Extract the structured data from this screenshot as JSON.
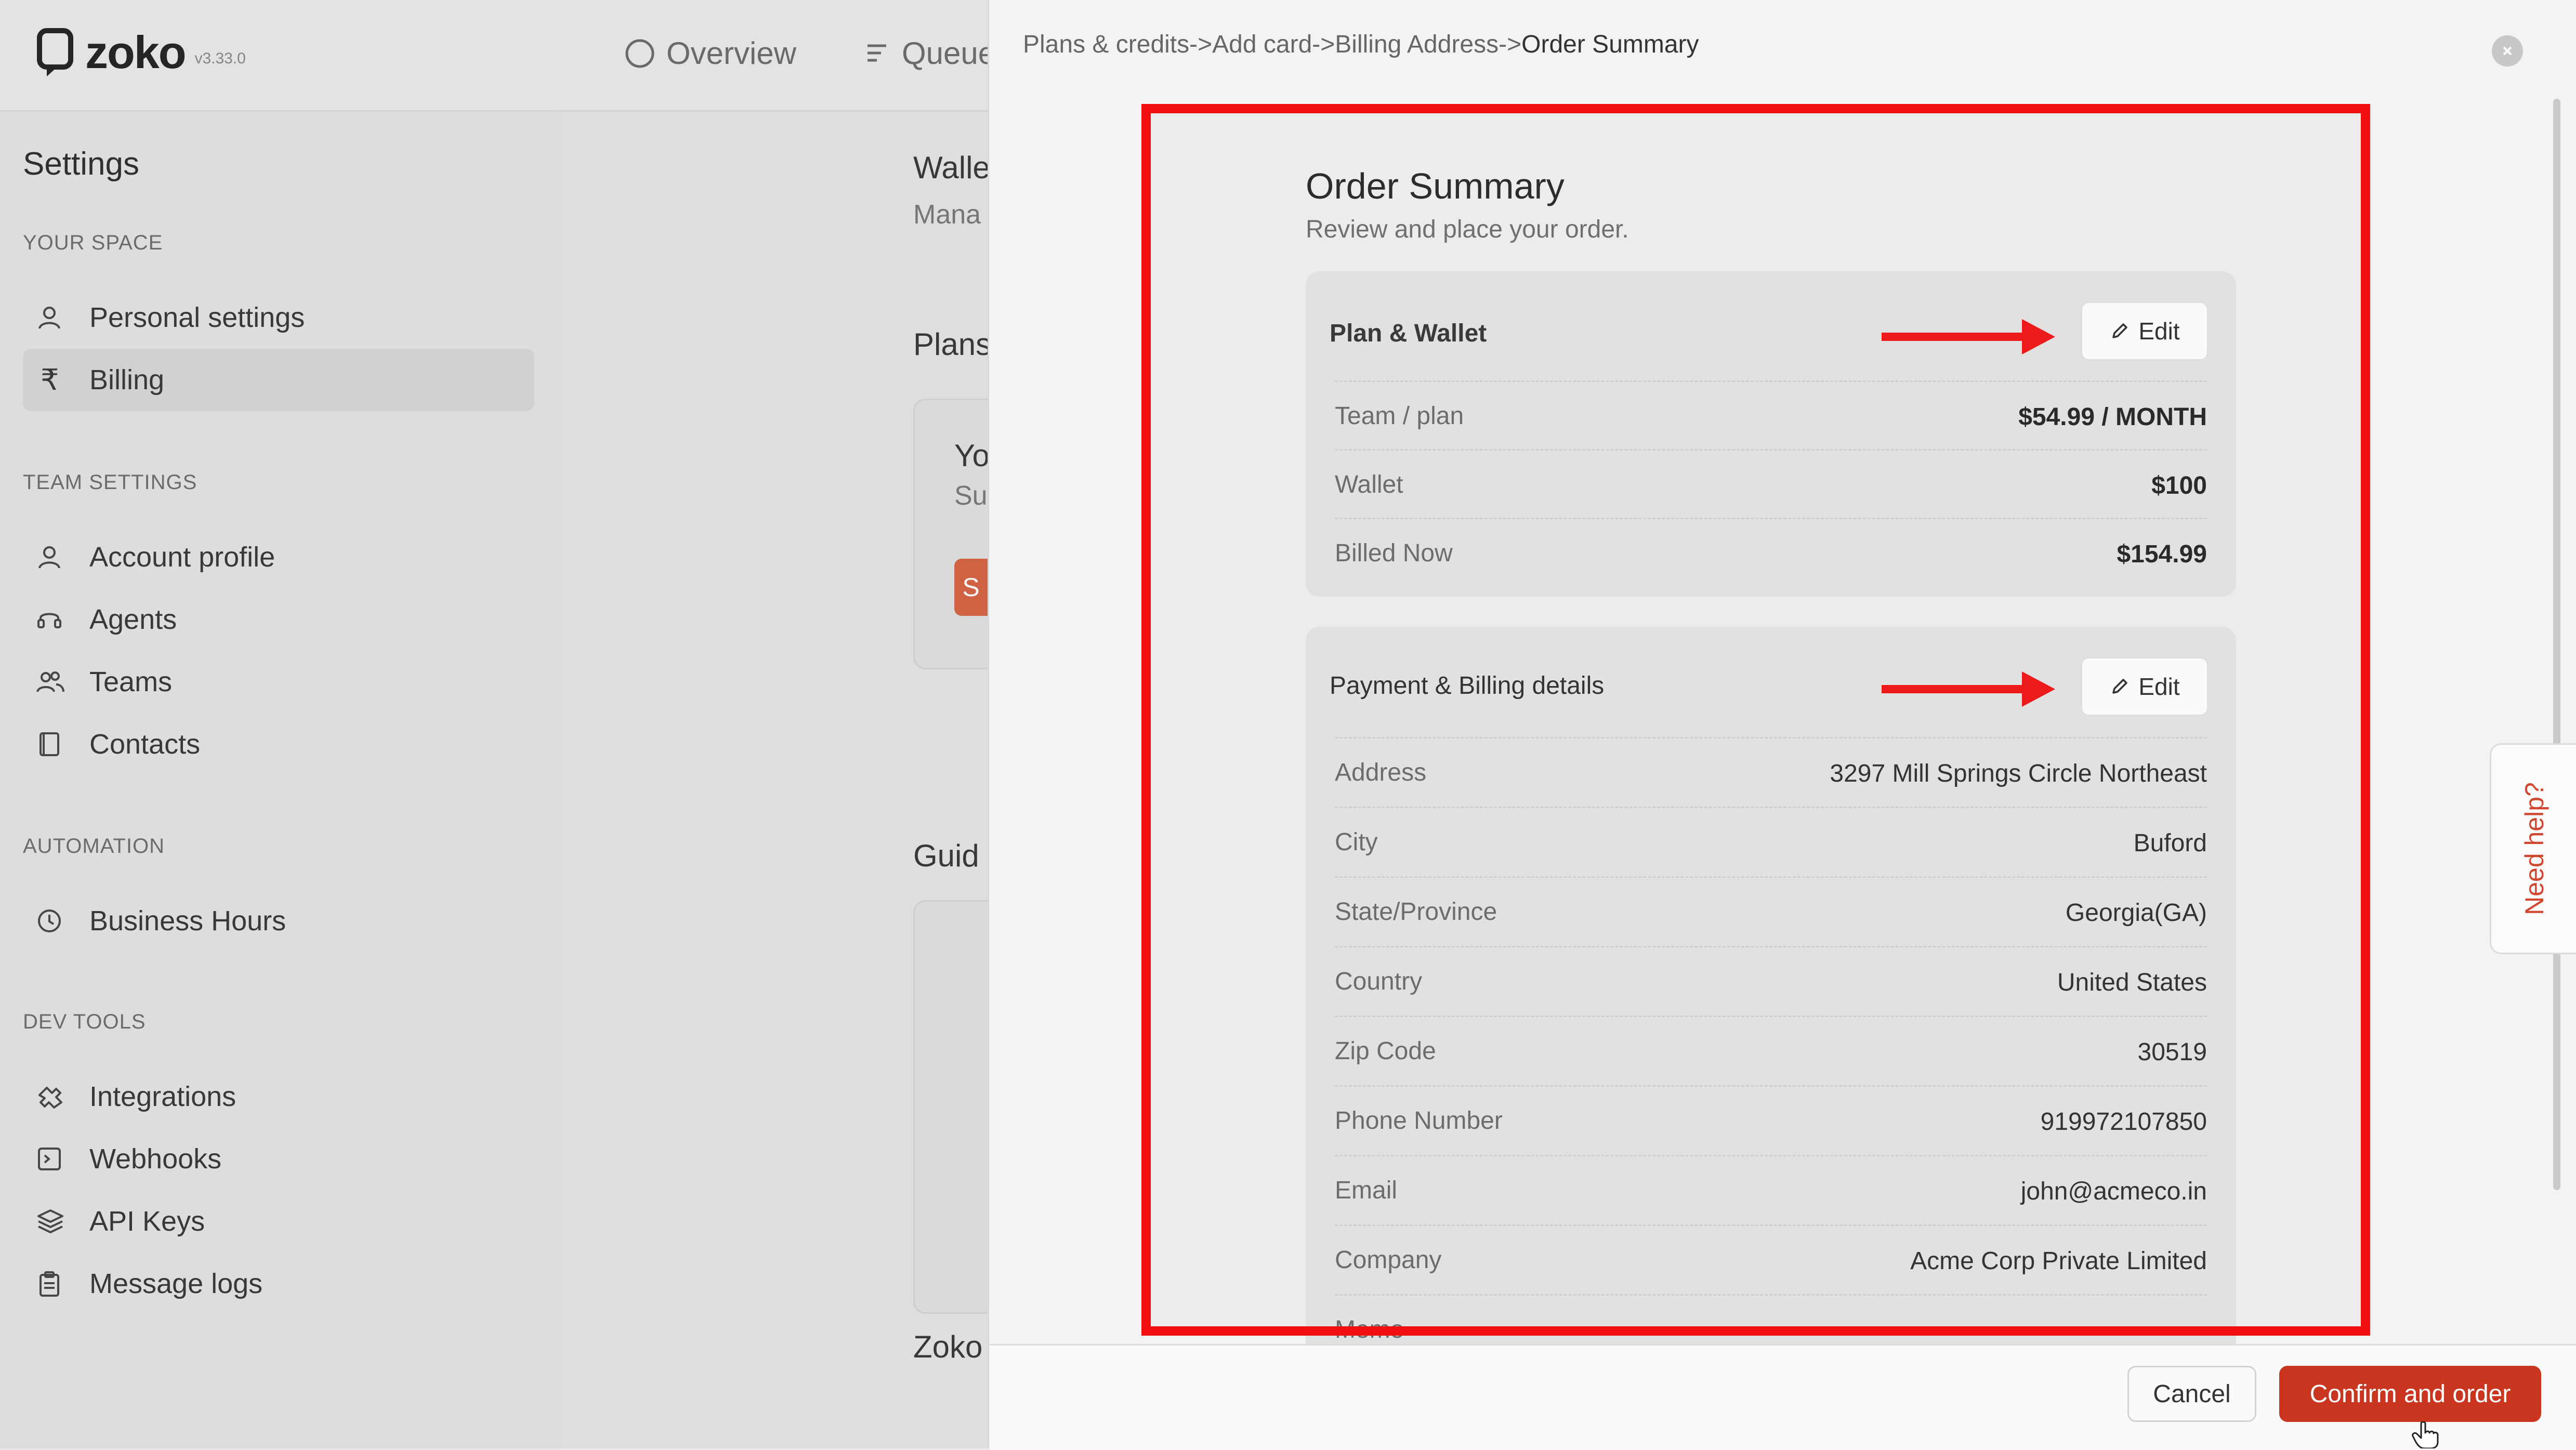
{
  "app": {
    "name": "zoko",
    "version": "v3.33.0"
  },
  "nav": {
    "overview": "Overview",
    "queue": "Queue"
  },
  "sidebar": {
    "title": "Settings",
    "your_space": "YOUR SPACE",
    "personal_settings": "Personal settings",
    "billing": "Billing",
    "team_settings": "TEAM SETTINGS",
    "account_profile": "Account profile",
    "agents": "Agents",
    "teams": "Teams",
    "contacts": "Contacts",
    "automation": "AUTOMATION",
    "business_hours": "Business Hours",
    "dev_tools": "DEV TOOLS",
    "integrations": "Integrations",
    "webhooks": "Webhooks",
    "api_keys": "API Keys",
    "message_logs": "Message logs"
  },
  "background": {
    "wallet": "Walle",
    "manage": "Mana",
    "plans": "Plans",
    "yo": "Yo",
    "su": "Su",
    "btn": "S",
    "guide": "Guid",
    "zoko": "Zoko"
  },
  "breadcrumb": {
    "trail": "Plans & credits->Add card->Billing Address->",
    "current": "Order Summary"
  },
  "order": {
    "title": "Order Summary",
    "subtitle": "Review and place your order.",
    "plan_wallet": {
      "heading": "Plan & Wallet",
      "edit": "Edit",
      "rows": [
        {
          "label": "Team / plan",
          "value": "$54.99 / MONTH"
        },
        {
          "label": "Wallet",
          "value": "$100"
        },
        {
          "label": "Billed Now",
          "value": "$154.99"
        }
      ]
    },
    "billing": {
      "heading": "Payment & Billing details",
      "edit": "Edit",
      "rows": [
        {
          "label": "Address",
          "value": "3297 Mill Springs Circle Northeast"
        },
        {
          "label": "City",
          "value": "Buford"
        },
        {
          "label": "State/Province",
          "value": "Georgia(GA)"
        },
        {
          "label": "Country",
          "value": "United States"
        },
        {
          "label": "Zip Code",
          "value": "30519"
        },
        {
          "label": "Phone Number",
          "value": "919972107850"
        },
        {
          "label": "Email",
          "value": "john@acmeco.in"
        },
        {
          "label": "Company",
          "value": "Acme Corp Private Limited"
        },
        {
          "label": "Memo",
          "value": ""
        }
      ]
    }
  },
  "footer": {
    "cancel": "Cancel",
    "confirm": "Confirm and order"
  },
  "help": {
    "label": "Need help?"
  },
  "colors": {
    "accent": "#c9351f",
    "highlight": "#f01010",
    "help_text": "#d0462f"
  }
}
